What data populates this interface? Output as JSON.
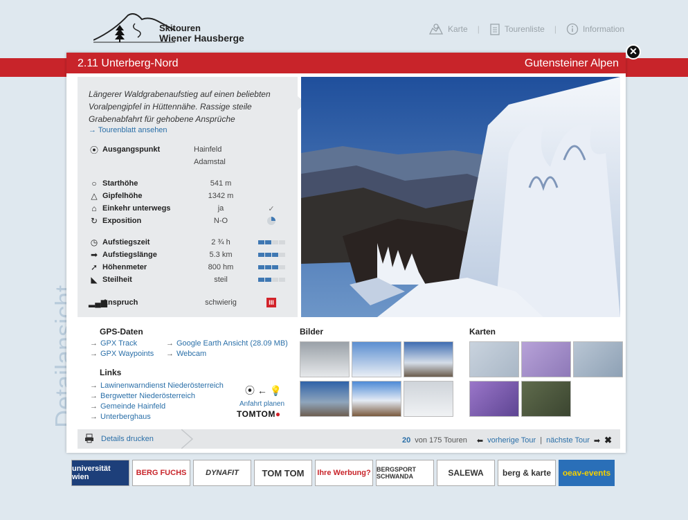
{
  "logo": {
    "line1": "Skitouren",
    "line2": "Wiener Hausberge"
  },
  "nav": [
    {
      "label": "Karte",
      "icon": "map-icon"
    },
    {
      "label": "Tourenliste",
      "icon": "list-icon"
    },
    {
      "label": "Information",
      "icon": "info-icon"
    }
  ],
  "tour": {
    "title": "2.11 Unterberg-Nord",
    "region": "Gutensteiner Alpen",
    "description": "Längerer Waldgrabenaufstieg auf einen beliebten Voralpengipfel in Hüttennähe. Rassige steile Grabenabfahrt für gehobene Ansprüche",
    "tourenblatt_link": "Tourenblatt ansehen"
  },
  "facts": {
    "ausgangspunkt": {
      "label": "Ausgangspunkt",
      "value1": "Hainfeld",
      "value2": "Adamstal"
    },
    "starthoehe": {
      "label": "Starthöhe",
      "value": "541 m"
    },
    "gipfelhoehe": {
      "label": "Gipfelhöhe",
      "value": "1342 m"
    },
    "einkehr": {
      "label": "Einkehr unterwegs",
      "value": "ja"
    },
    "exposition": {
      "label": "Exposition",
      "value": "N-O"
    },
    "aufstiegszeit": {
      "label": "Aufstiegszeit",
      "value": "2 ¾ h",
      "level": 2
    },
    "aufstiegslaenge": {
      "label": "Aufstiegslänge",
      "value": "5.3 km",
      "level": 3
    },
    "hoehenmeter": {
      "label": "Höhenmeter",
      "value": "800 hm",
      "level": 3
    },
    "steilheit": {
      "label": "Steilheit",
      "value": "steil",
      "level": 2
    },
    "anspruch": {
      "label": "Anspruch",
      "value": "schwierig",
      "badge": "III"
    }
  },
  "gps": {
    "heading": "GPS-Daten",
    "track": "GPX Track",
    "waypoints": "GPX Waypoints",
    "google_earth": "Google Earth Ansicht",
    "google_earth_size": "(28.09 MB)",
    "webcam": "Webcam"
  },
  "links": {
    "heading": "Links",
    "items": [
      "Lawinenwarndienst Niederösterreich",
      "Bergwetter Niederösterreich",
      "Gemeinde Hainfeld",
      "Unterberghaus"
    ],
    "anfahrt": "Anfahrt planen",
    "tomtom": "TOMTOM"
  },
  "bilder": {
    "heading": "Bilder"
  },
  "karten": {
    "heading": "Karten"
  },
  "footer": {
    "print": "Details drucken",
    "current": "20",
    "of_text": "von 175 Touren",
    "prev": "vorherige Tour",
    "sep": "|",
    "next": "nächste Tour"
  },
  "side_text": "Detailansicht",
  "sponsors": [
    "universität wien",
    "BERG FUCHS",
    "DYNAFIT",
    "TOM TOM",
    "Ihre Werbung?",
    "BERGSPORT SCHWANDA",
    "SALEWA",
    "berg & karte",
    "oeav-events"
  ],
  "colors": {
    "accent": "#c8242a",
    "link": "#2a6fa8",
    "bar_on": "#3f78b3"
  }
}
